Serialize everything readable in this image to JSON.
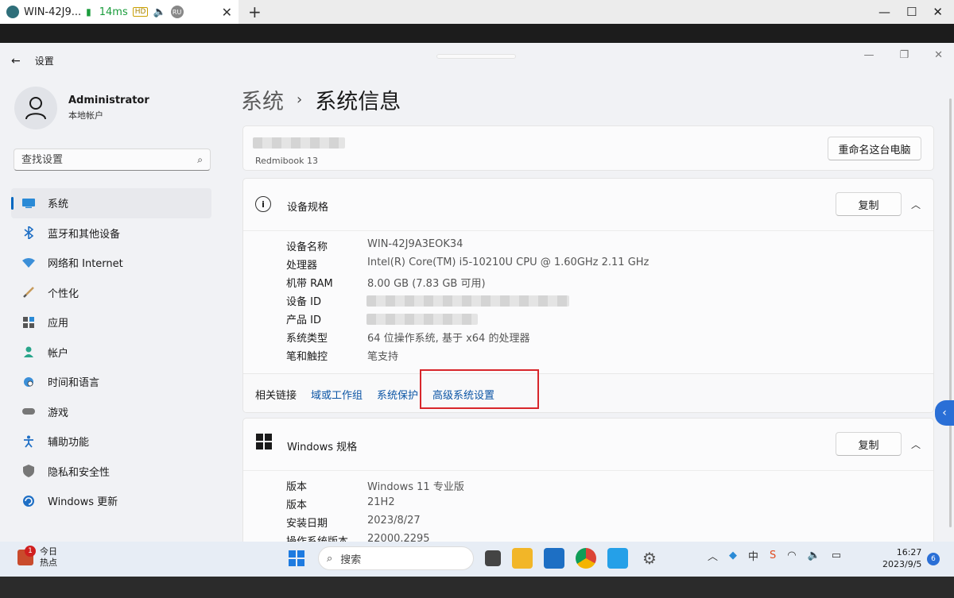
{
  "remote": {
    "tab_title": "WIN-42J9...",
    "latency": "14ms",
    "hd": "HD",
    "lang": "RU",
    "close": "✕",
    "new_tab": "+",
    "minimize": "—",
    "maximize": "☐",
    "close_window": "✕"
  },
  "window": {
    "back": "←",
    "title": "设置",
    "minimize": "—",
    "maximize": "❐",
    "close": "✕"
  },
  "user": {
    "name": "Administrator",
    "account_type": "本地帐户"
  },
  "search": {
    "placeholder": "查找设置"
  },
  "sidebar": {
    "items": [
      {
        "label": "系统",
        "icon": "monitor-icon"
      },
      {
        "label": "蓝牙和其他设备",
        "icon": "bluetooth-icon"
      },
      {
        "label": "网络和 Internet",
        "icon": "wifi-icon"
      },
      {
        "label": "个性化",
        "icon": "brush-icon"
      },
      {
        "label": "应用",
        "icon": "apps-icon"
      },
      {
        "label": "帐户",
        "icon": "person-icon"
      },
      {
        "label": "时间和语言",
        "icon": "globe-clock-icon"
      },
      {
        "label": "游戏",
        "icon": "gamepad-icon"
      },
      {
        "label": "辅助功能",
        "icon": "accessibility-icon"
      },
      {
        "label": "隐私和安全性",
        "icon": "shield-icon"
      },
      {
        "label": "Windows 更新",
        "icon": "update-icon"
      }
    ]
  },
  "breadcrumb": {
    "parent": "系统",
    "separator": "›",
    "current": "系统信息"
  },
  "pc": {
    "model": "Redmibook 13",
    "rename_button": "重命名这台电脑"
  },
  "device_specs": {
    "title": "设备规格",
    "copy_button": "复制",
    "rows": [
      {
        "key": "设备名称",
        "value": "WIN-42J9A3EOK34"
      },
      {
        "key": "处理器",
        "value": "Intel(R) Core(TM) i5-10210U CPU @ 1.60GHz   2.11 GHz"
      },
      {
        "key": "机带 RAM",
        "value": "8.00 GB (7.83 GB 可用)"
      },
      {
        "key": "设备 ID",
        "value": ""
      },
      {
        "key": "产品 ID",
        "value": ""
      },
      {
        "key": "系统类型",
        "value": "64 位操作系统, 基于 x64 的处理器"
      },
      {
        "key": "笔和触控",
        "value": "笔支持"
      }
    ]
  },
  "related": {
    "label": "相关链接",
    "links": [
      "域或工作组",
      "系统保护",
      "高级系统设置"
    ]
  },
  "windows_specs": {
    "title": "Windows 规格",
    "copy_button": "复制",
    "rows": [
      {
        "key": "版本",
        "value": "Windows 11 专业版"
      },
      {
        "key": "版本",
        "value": "21H2"
      },
      {
        "key": "安装日期",
        "value": "2023/8/27"
      },
      {
        "key": "操作系统版本",
        "value": "22000.2295"
      }
    ]
  },
  "taskbar": {
    "news_title": "今日",
    "news_sub": "热点",
    "news_badge": "1",
    "search_label": "搜索",
    "time": "16:27",
    "date": "2023/9/5",
    "notifications": "6",
    "ime": "中"
  },
  "colors": {
    "accent": "#0067c0",
    "link": "#0b55a5",
    "highlight_box": "#d8262b"
  }
}
